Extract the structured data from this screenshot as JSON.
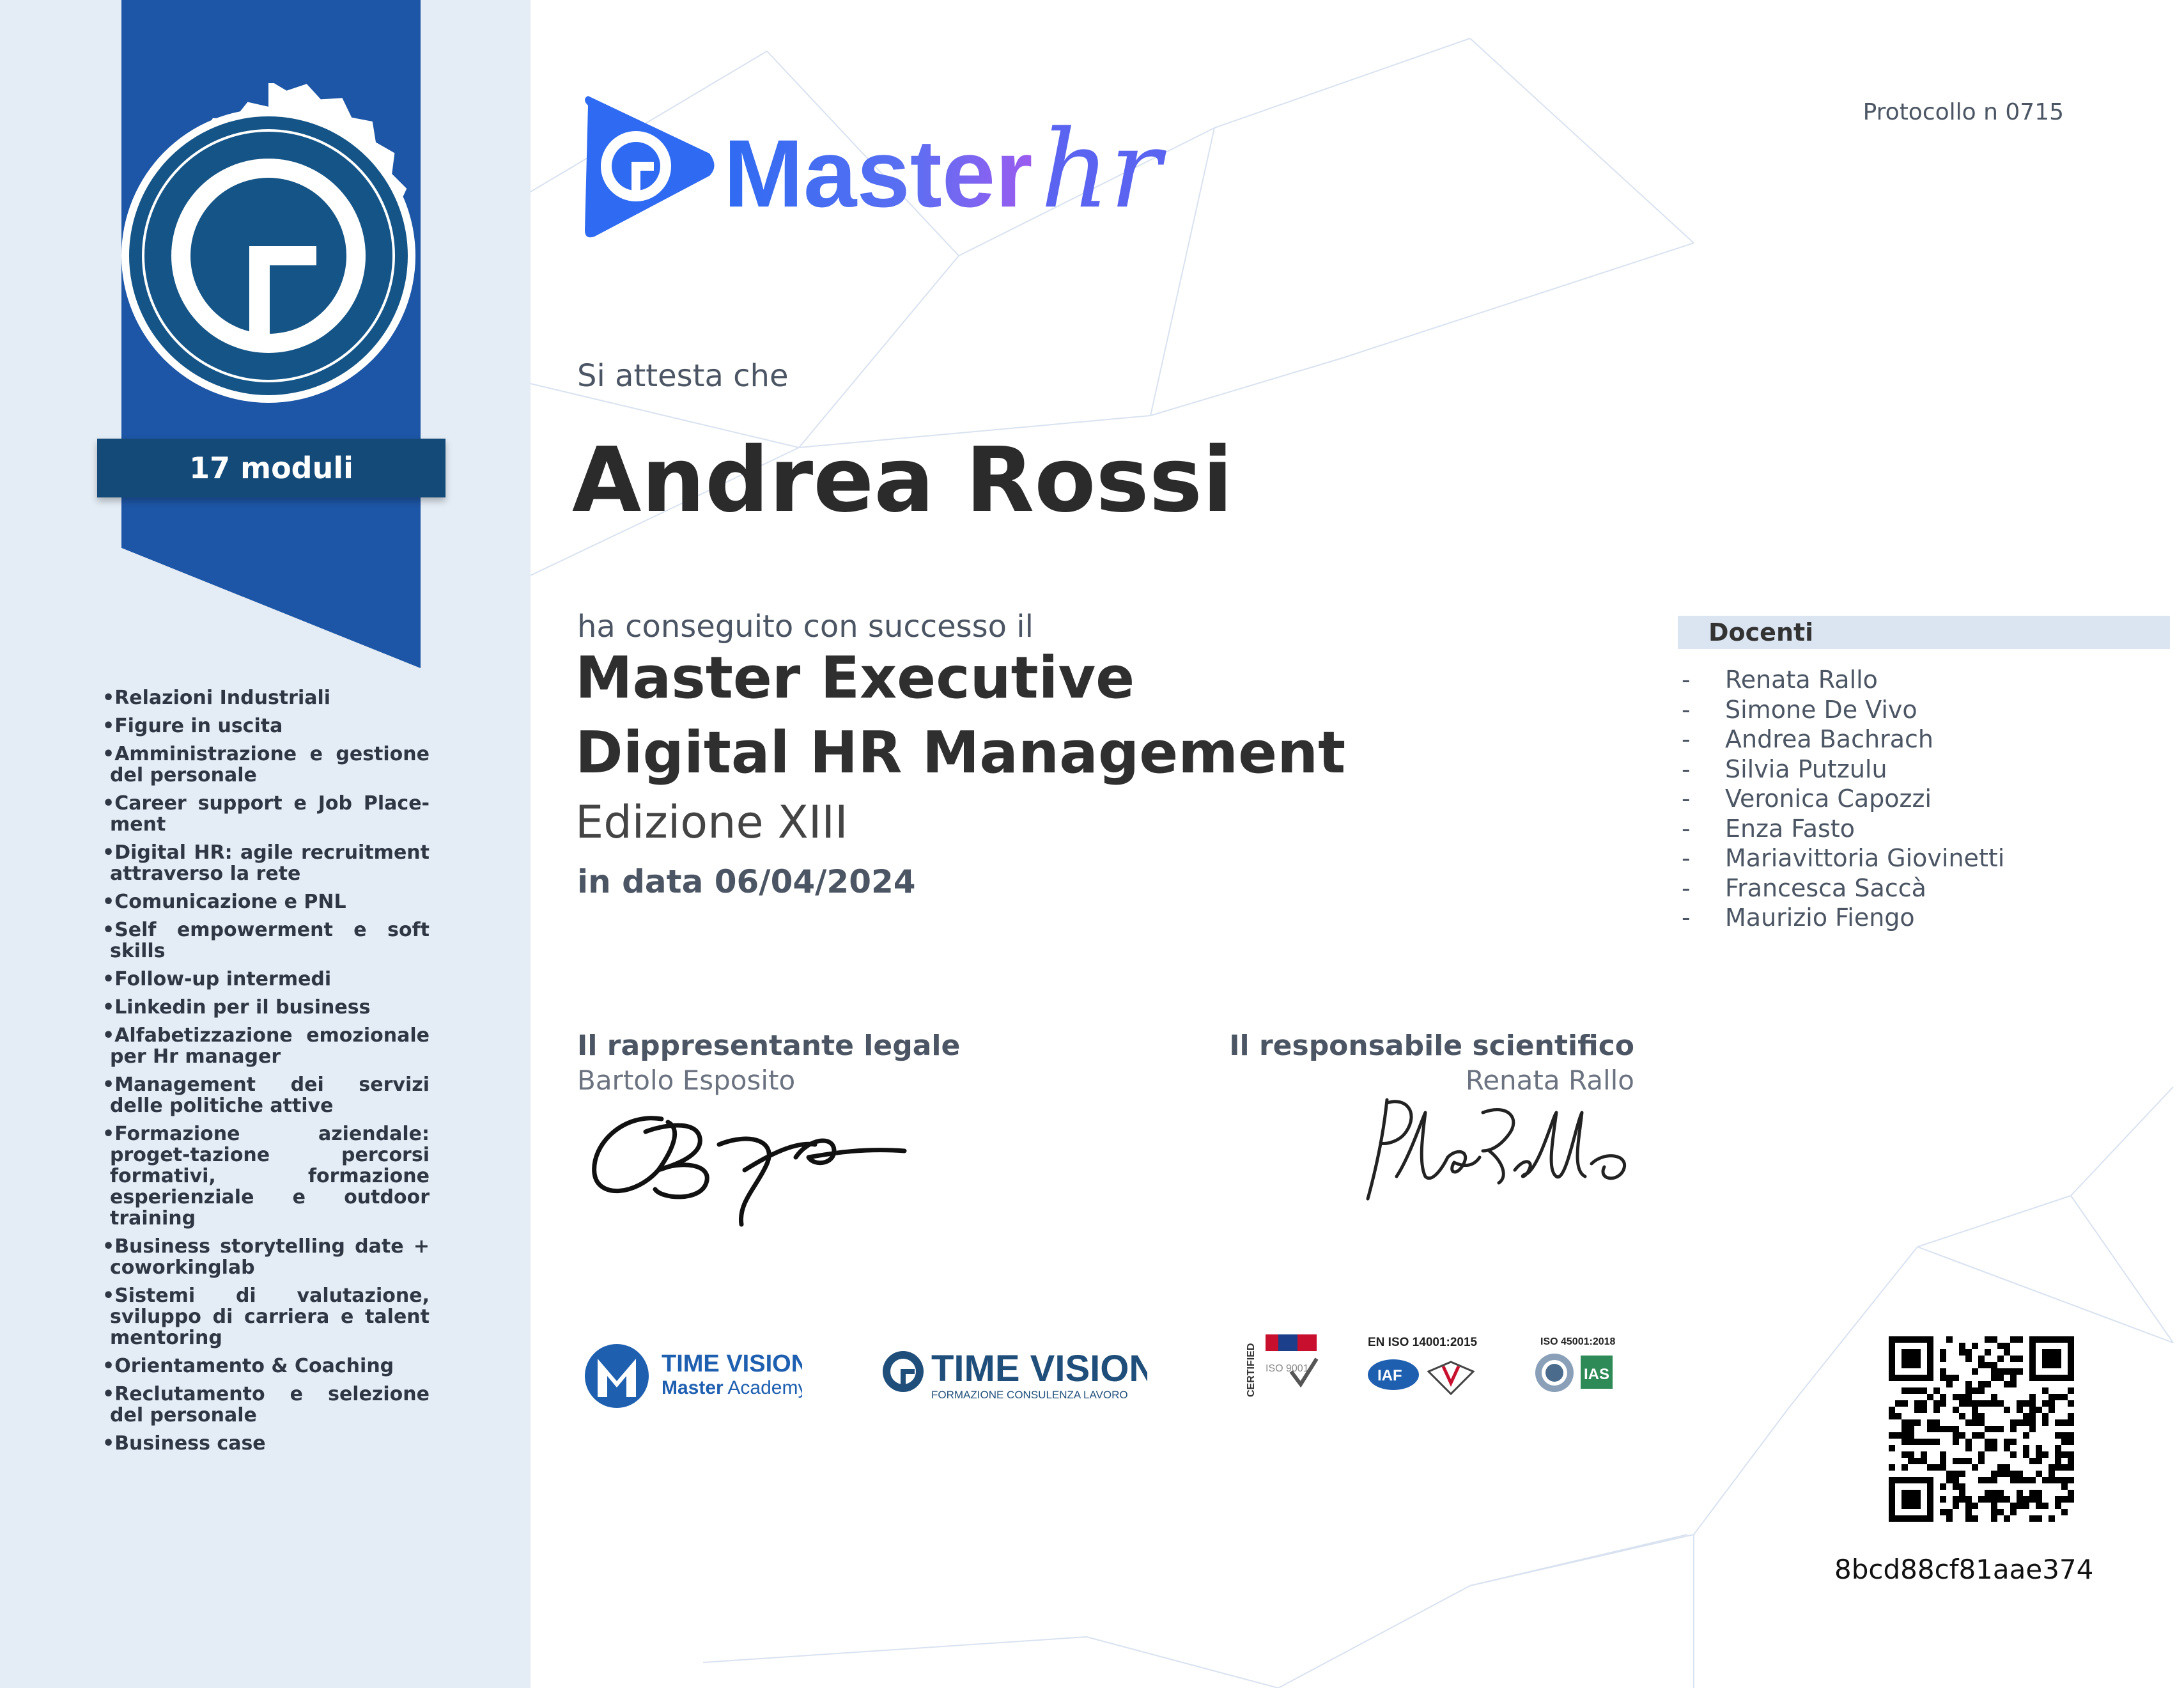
{
  "protocol": "Protocollo n 0715",
  "brand": {
    "word": "Master",
    "script": "hr"
  },
  "badge": {
    "modules": "17 moduli"
  },
  "modules": [
    "Relazioni Industriali",
    "Figure in uscita",
    "Amministrazione e gestione del personale",
    "Career support e Job Place-ment",
    "Digital HR: agile recruitment attraverso la rete",
    "Comunicazione e PNL",
    "Self empowerment e soft skills",
    "Follow-up intermedi",
    "Linkedin per il business",
    "Alfabetizzazione emozionale per Hr manager",
    "Management dei servizi delle politiche attive",
    "Formazione aziendale: proget-tazione percorsi formativi, formazione esperienziale e outdoor training",
    "Business storytelling date + coworkinglab",
    "Sistemi di valutazione, sviluppo di carriera e talent mentoring",
    "Orientamento & Coaching",
    "Reclutamento e selezione del personale",
    "Business case"
  ],
  "certificate": {
    "attest": "Si attesta che",
    "recipient": "Andrea Rossi",
    "achieved": "ha conseguito con successo il",
    "title_line1": "Master Executive",
    "title_line2": "Digital HR Management",
    "edition": "Edizione XIII",
    "date": "in data 06/04/2024"
  },
  "docenti": {
    "header": "Docenti",
    "names": [
      "Renata Rallo",
      "Simone De Vivo",
      "Andrea Bachrach",
      "Silvia Putzulu",
      "Veronica Capozzi",
      "Enza Fasto",
      "Mariavittoria Giovinetti",
      "Francesca Saccà",
      "Maurizio Fiengo"
    ]
  },
  "signatures": {
    "left": {
      "title": "Il rappresentante legale",
      "name": "Bartolo Esposito"
    },
    "right": {
      "title": "Il responsabile scientifico",
      "name": "Renata Rallo"
    }
  },
  "footer_logos": {
    "academy": {
      "line1": "TIME VISION",
      "line2_bold": "Master",
      "line2": "Academy"
    },
    "tv": {
      "line1": "TIME VISION",
      "line2": "FORMAZIONE CONSULENZA LAVORO"
    },
    "certified": "CERTIFIED",
    "iso9001": "ISO 9001",
    "iso14001": "EN ISO 14001:2015",
    "iso45001": "ISO 45001:2018",
    "iaf": "IAF",
    "ias": "IAS"
  },
  "verification_code": "8bcd88cf81aae374",
  "colors": {
    "ribbon": "#1d56a6",
    "sidebar": "#e4ecf5",
    "accent": "#2f6bf2",
    "purple": "#7b5cf0"
  }
}
